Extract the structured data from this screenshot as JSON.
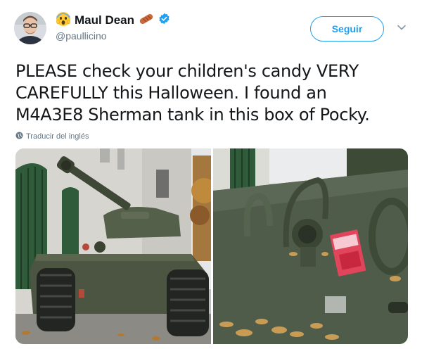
{
  "account": {
    "display_name": "Maul Dean",
    "handle": "@paullicino",
    "verified": true,
    "name_prefix_icon": "face-screaming-emoji-icon",
    "name_suffix_icon": "sausage-emoji-icon"
  },
  "follow_button": {
    "label": "Seguir"
  },
  "tweet": {
    "lines": [
      "PLEASE check your children's candy VERY",
      "CAREFULLY this Halloween. I found an",
      "M4A3E8 Sherman tank in this box of Pocky."
    ]
  },
  "translate": {
    "label": "Traducir del inglés",
    "icon": "globe-icon"
  },
  "media": [
    {
      "description_icon": "tank-photo",
      "count": 1
    },
    {
      "description_icon": "tank-closeup-pocky-photo",
      "count": 2
    }
  ],
  "colors": {
    "accent": "#1da1f2",
    "text": "#14171a",
    "secondary": "#657786"
  }
}
